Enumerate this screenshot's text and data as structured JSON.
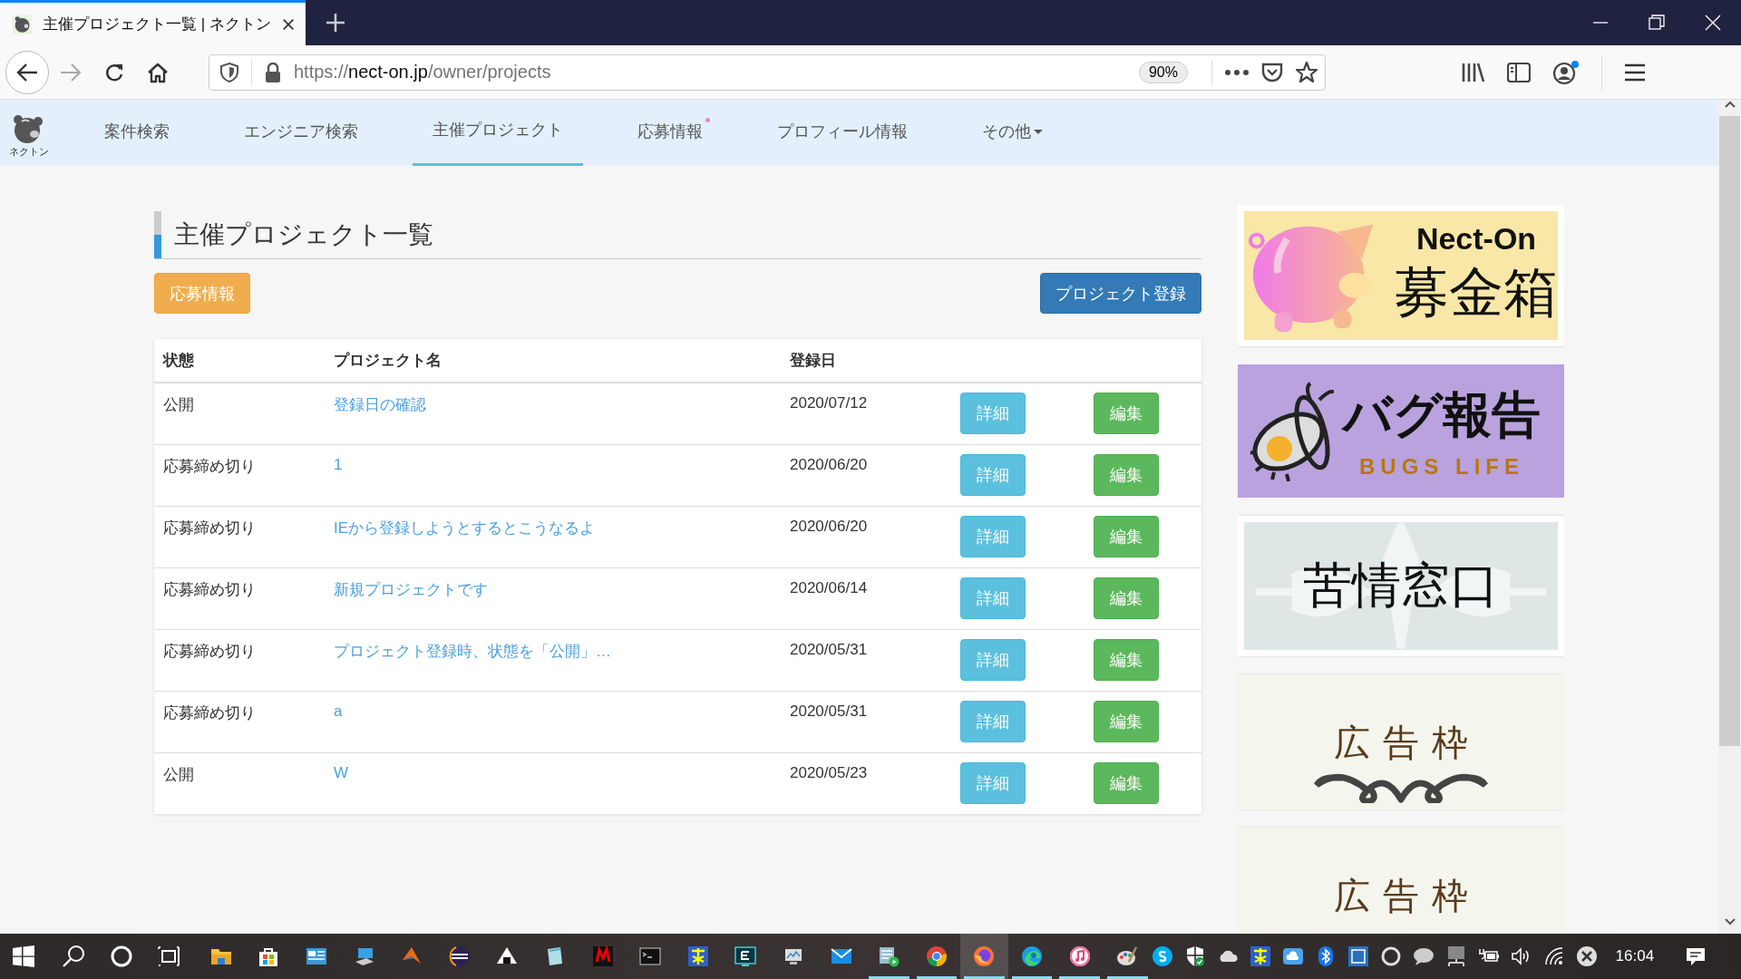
{
  "browser": {
    "tab": {
      "title": "主催プロジェクト一覧 | ネクトン",
      "selected": true
    },
    "url": "https://nect-on.jp/owner/projects",
    "zoom": "90%"
  },
  "navbar": {
    "logo_text": "ネクトン",
    "items": [
      {
        "label": "案件検索",
        "kind": "link",
        "selected": false,
        "dot": false
      },
      {
        "label": "エンジニア検索",
        "kind": "link",
        "selected": false,
        "dot": false
      },
      {
        "label": "主催プロジェクト",
        "kind": "link",
        "selected": true,
        "dot": false
      },
      {
        "label": "応募情報",
        "kind": "link",
        "selected": false,
        "dot": true
      },
      {
        "label": "プロフィール情報",
        "kind": "link",
        "selected": false,
        "dot": false
      },
      {
        "label": "その他",
        "kind": "dropdown",
        "selected": false,
        "dot": false
      }
    ]
  },
  "page": {
    "title": "主催プロジェクト一覧",
    "buttons": [
      {
        "label": "応募情報",
        "kind": "warning"
      },
      {
        "label": "プロジェクト登録",
        "kind": "primary"
      }
    ],
    "table": {
      "columns": [
        "状態",
        "プロジェクト名",
        "登録日"
      ],
      "rows": [
        {
          "status": "公開",
          "name": "登録日の確認",
          "date": "2020/07/12",
          "actions": [
            {
              "label": "詳細",
              "kind": "info"
            },
            {
              "label": "編集",
              "kind": "success"
            }
          ]
        },
        {
          "status": "応募締め切り",
          "name": "1",
          "date": "2020/06/20",
          "actions": [
            {
              "label": "詳細",
              "kind": "info"
            },
            {
              "label": "編集",
              "kind": "success"
            }
          ]
        },
        {
          "status": "応募締め切り",
          "name": "IEから登録しようとするとこうなるよ",
          "date": "2020/06/20",
          "actions": [
            {
              "label": "詳細",
              "kind": "info"
            },
            {
              "label": "編集",
              "kind": "success"
            }
          ]
        },
        {
          "status": "応募締め切り",
          "name": "新規プロジェクトです",
          "date": "2020/06/14",
          "actions": [
            {
              "label": "詳細",
              "kind": "info"
            },
            {
              "label": "編集",
              "kind": "success"
            }
          ]
        },
        {
          "status": "応募締め切り",
          "name": "プロジェクト登録時、状態を「公開」…",
          "date": "2020/05/31",
          "actions": [
            {
              "label": "詳細",
              "kind": "info"
            },
            {
              "label": "編集",
              "kind": "success"
            }
          ]
        },
        {
          "status": "応募締め切り",
          "name": "a",
          "date": "2020/05/31",
          "actions": [
            {
              "label": "詳細",
              "kind": "info"
            },
            {
              "label": "編集",
              "kind": "success"
            }
          ]
        },
        {
          "status": "公開",
          "name": "W",
          "date": "2020/05/23",
          "actions": [
            {
              "label": "詳細",
              "kind": "info"
            },
            {
              "label": "編集",
              "kind": "success"
            }
          ]
        }
      ]
    }
  },
  "sidebar": {
    "banners": [
      {
        "kind": "donation",
        "texts": [
          "Nect-On",
          "募金箱"
        ]
      },
      {
        "kind": "bug",
        "texts": [
          "バグ報告",
          "BUGS LIFE"
        ]
      },
      {
        "kind": "complaint",
        "texts": [
          "苦情窓口"
        ]
      },
      {
        "kind": "ad",
        "texts": [
          "広告枠"
        ]
      },
      {
        "kind": "ad",
        "texts": [
          "広告枠"
        ]
      }
    ]
  },
  "taskbar": {
    "apps": [
      {
        "running": false,
        "selected": false
      },
      {
        "running": false,
        "selected": false
      },
      {
        "running": false,
        "selected": false
      },
      {
        "running": false,
        "selected": false
      },
      {
        "running": false,
        "selected": false
      },
      {
        "running": false,
        "selected": false
      },
      {
        "running": false,
        "selected": false
      },
      {
        "running": false,
        "selected": false
      },
      {
        "running": false,
        "selected": false
      },
      {
        "running": false,
        "selected": false
      },
      {
        "running": false,
        "selected": false
      },
      {
        "running": false,
        "selected": false
      },
      {
        "running": false,
        "selected": false
      },
      {
        "running": false,
        "selected": false
      },
      {
        "running": true,
        "selected": false
      },
      {
        "running": true,
        "selected": false
      },
      {
        "running": true,
        "selected": true
      },
      {
        "running": true,
        "selected": false
      },
      {
        "running": true,
        "selected": false
      },
      {
        "running": true,
        "selected": false
      }
    ],
    "time": "16:04"
  }
}
